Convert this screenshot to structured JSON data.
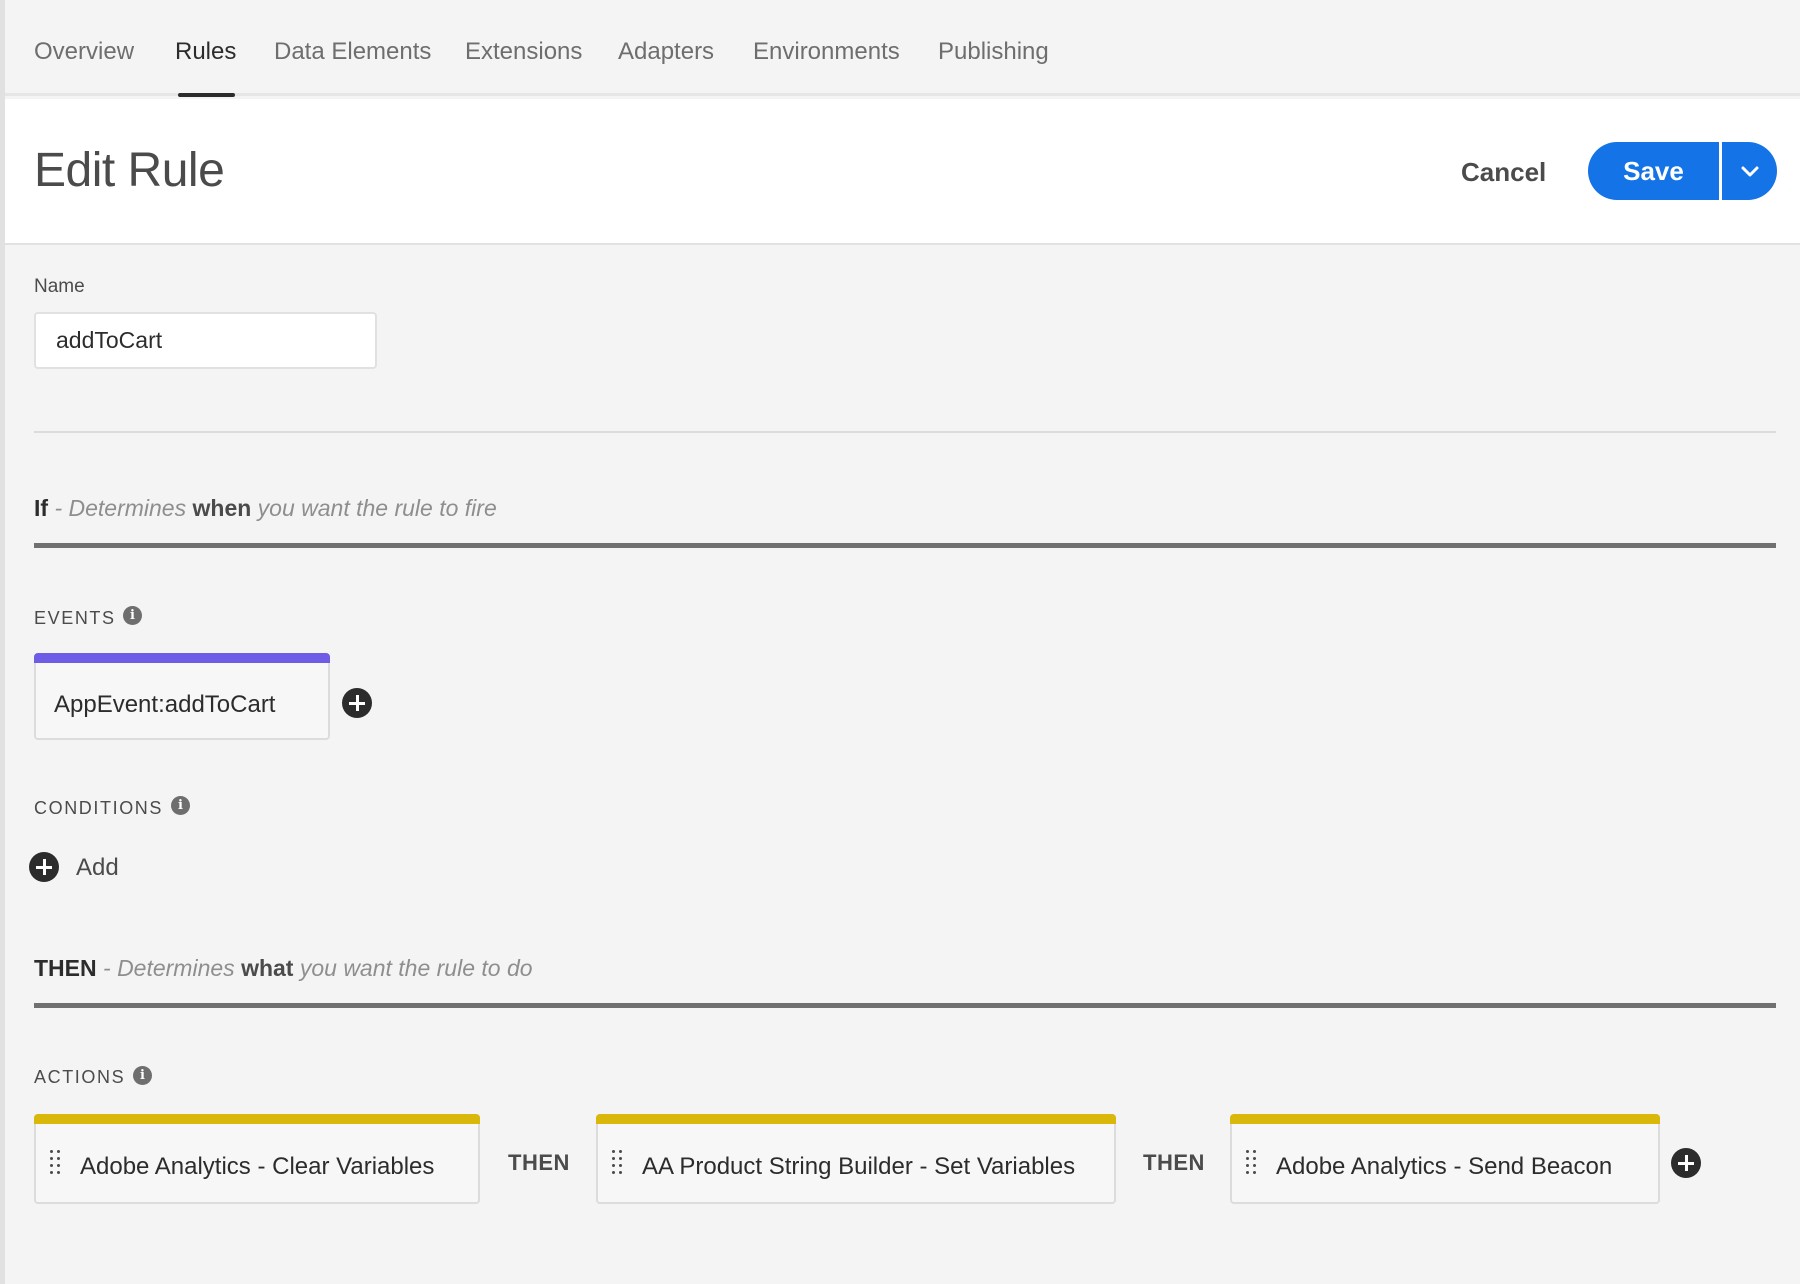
{
  "nav": {
    "tabs": [
      {
        "label": "Overview"
      },
      {
        "label": "Rules",
        "active": true
      },
      {
        "label": "Data Elements"
      },
      {
        "label": "Extensions"
      },
      {
        "label": "Adapters"
      },
      {
        "label": "Environments"
      },
      {
        "label": "Publishing"
      }
    ]
  },
  "header": {
    "title": "Edit Rule",
    "cancel_label": "Cancel",
    "save_label": "Save",
    "save_menu_icon": "chevron-down-icon"
  },
  "form": {
    "name_label": "Name",
    "name_value": "addToCart"
  },
  "if_section": {
    "keyword": "If",
    "desc_prefix": " - Determines ",
    "desc_emphasis": "when",
    "desc_suffix": " you want the rule to fire"
  },
  "events": {
    "heading": "EVENTS",
    "items": [
      {
        "label": "AppEvent:addToCart",
        "bar_color": "#6e5ce6"
      }
    ]
  },
  "conditions": {
    "heading": "CONDITIONS",
    "add_label": "Add"
  },
  "then_section": {
    "keyword": "THEN",
    "desc_prefix": " - Determines ",
    "desc_emphasis": "what",
    "desc_suffix": " you want the rule to do"
  },
  "actions": {
    "heading": "ACTIONS",
    "connector": "THEN",
    "bar_color": "#d9b80b",
    "items": [
      {
        "label": "Adobe Analytics - Clear Variables"
      },
      {
        "label": "AA Product String Builder - Set Variables"
      },
      {
        "label": "Adobe Analytics - Send Beacon"
      }
    ]
  },
  "colors": {
    "accent": "#1473e6",
    "event_bar": "#6e5ce6",
    "action_bar": "#d9b80b"
  }
}
